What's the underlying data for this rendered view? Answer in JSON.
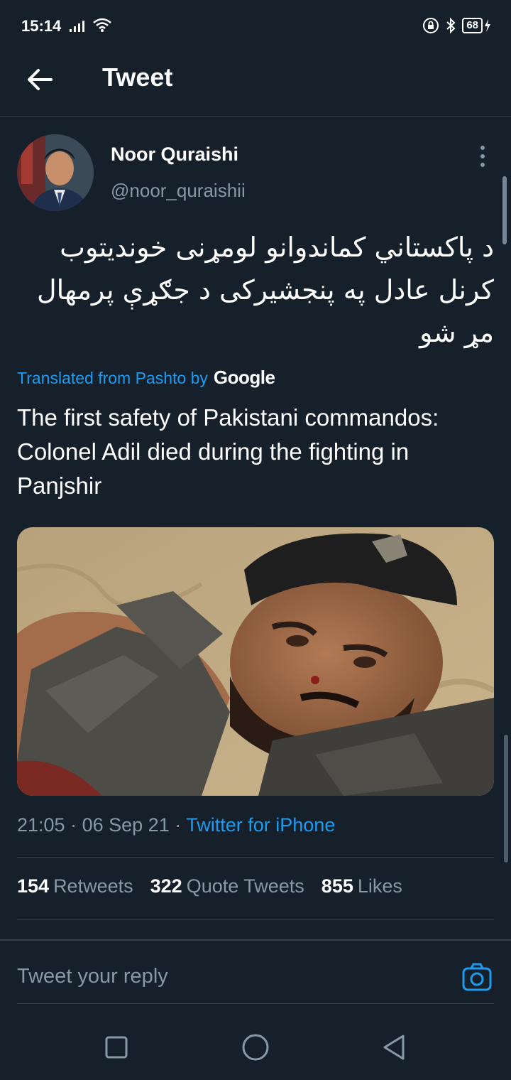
{
  "status_bar": {
    "time": "15:14",
    "battery": "68",
    "icons": [
      "signal-icon",
      "wifi-icon",
      "lock-rotation-icon",
      "bluetooth-icon",
      "battery-icon",
      "charging-icon"
    ]
  },
  "header": {
    "title": "Tweet",
    "back_icon": "arrow-left-icon"
  },
  "tweet": {
    "author_name": "Noor Quraishi",
    "author_handle": "@noor_quraishii",
    "original_text_lines": [
      "د پاکستاني کماندوانو لومړنی خوندیتوب",
      "کرنل عادل په پنجشیرکی د جګړې پرمهال",
      "مړ شو"
    ],
    "translated_from": "Translated from Pashto by",
    "translator_brand": "Google",
    "translation_lines": [
      "The first safety of Pakistani commandos:",
      "Colonel Adil died during the fighting in",
      "Panjshir"
    ],
    "time": "21:05",
    "date": "06 Sep 21",
    "separator": "·",
    "source": "Twitter for iPhone"
  },
  "stats": {
    "retweets_count": "154",
    "retweets_label": "Retweets",
    "quotes_count": "322",
    "quotes_label": "Quote Tweets",
    "likes_count": "855",
    "likes_label": "Likes"
  },
  "reply": {
    "placeholder": "Tweet your reply",
    "camera_icon": "camera-icon"
  },
  "nav_bar": {
    "buttons": [
      "recent-apps-icon",
      "home-icon",
      "back-triangle-icon"
    ]
  },
  "colors": {
    "background": "#15202b",
    "accent": "#1d9bf0",
    "secondary_text": "#8899a6",
    "divider": "#38444d"
  }
}
